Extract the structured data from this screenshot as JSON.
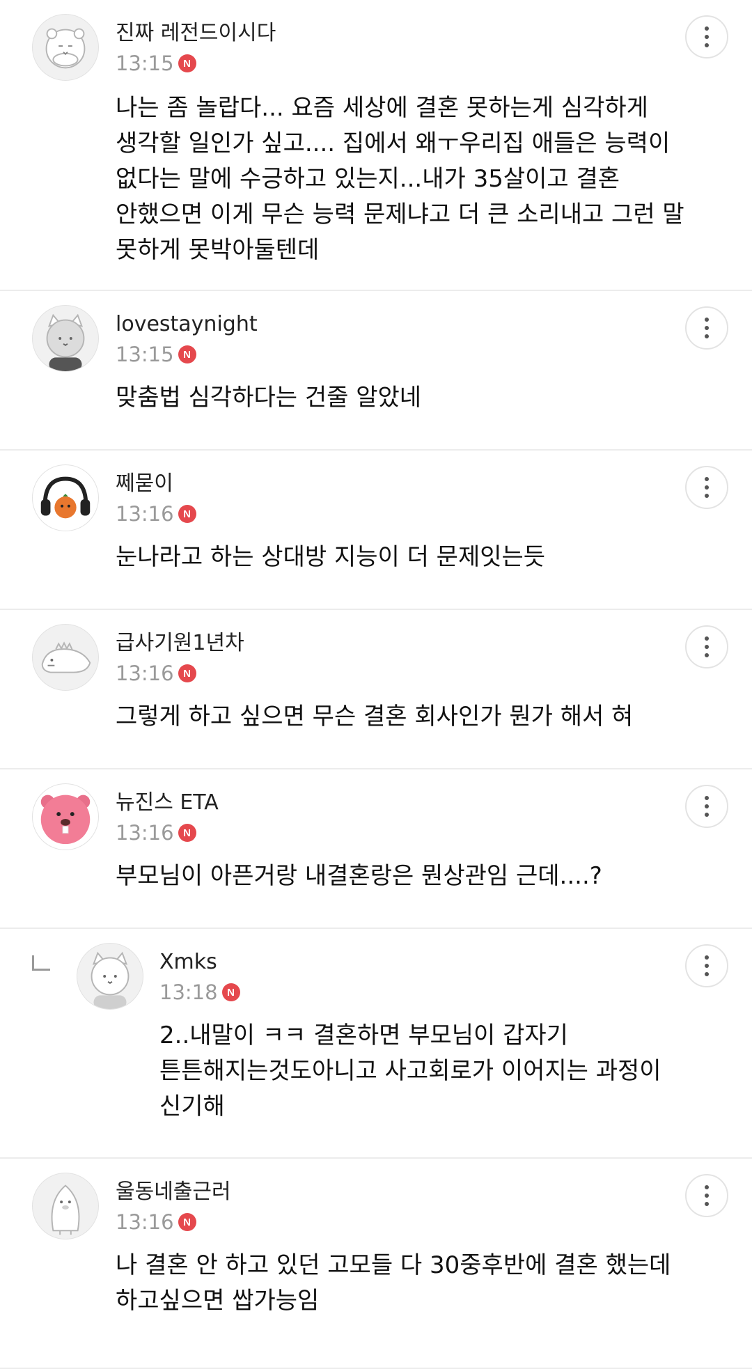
{
  "comments": [
    {
      "nickname": "진짜 레전드이시다",
      "time": "13:15",
      "badge": "N",
      "avatar_icon": "hamster-icon",
      "body": "나는 좀 놀랍다... 요즘 세상에 결혼 못하는게 심각하게\n생각할 일인가 싶고.... 집에서 왜ㅜ우리집 애들은 능력이\n없다는 말에 수긍하고 있는지...내가 35살이고 결혼\n안했으면 이게 무슨 능력 문제냐고 더 큰 소리내고 그런 말\n못하게 못박아둘텐데"
    },
    {
      "nickname": "lovestaynight",
      "time": "13:15",
      "badge": "N",
      "avatar_icon": "cat-icon",
      "body": "맞춤법 심각하다는 건줄 알았네"
    },
    {
      "nickname": "쩨묻이",
      "time": "13:16",
      "badge": "N",
      "avatar_icon": "headphone-character-icon",
      "body": "눈나라고 하는 상대방 지능이 더 문제잇는듯"
    },
    {
      "nickname": "급사기원1년차",
      "time": "13:16",
      "badge": "N",
      "avatar_icon": "dinosaur-icon",
      "body": "그렇게 하고 싶으면 무슨 결혼 회사인가 뭔가 해서 혀"
    },
    {
      "nickname": "뉴진스 ETA",
      "time": "13:16",
      "badge": "N",
      "avatar_icon": "pink-beaver-icon",
      "body": "부모님이 아픈거랑 내결혼랑은 뭔상관임 근데....?"
    },
    {
      "nickname": "Xmks",
      "time": "13:18",
      "badge": "N",
      "avatar_icon": "cat-icon",
      "body": "2..내말이 ㅋㅋ 결혼하면 부모님이 갑자기\n튼튼해지는것도아니고 사고회로가 이어지는 과정이\n신기해"
    },
    {
      "nickname": "울동네출근러",
      "time": "13:16",
      "badge": "N",
      "avatar_icon": "penguin-icon",
      "body": "나 결혼 안 하고 있던 고모들 다 30중후반에 결혼 했는데\n하고싶으면 쌉가능임"
    }
  ]
}
